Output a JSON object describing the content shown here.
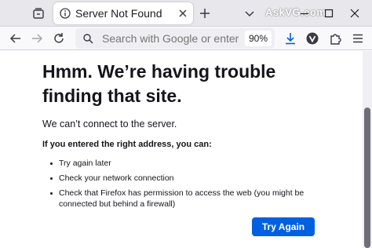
{
  "tab": {
    "title": "Server Not Found"
  },
  "watermark": "AskVG.com",
  "urlbar": {
    "placeholder": "Search with Google or enter address",
    "zoom": "90%"
  },
  "page": {
    "title": "Hmm. We’re having trouble finding that site.",
    "short_desc": "We can’t connect to the server.",
    "hint": "If you entered the right address, you can:",
    "suggestions": [
      "Try again later",
      "Check your network connection",
      "Check that Firefox has permission to access the web (you might be connected but behind a firewall)"
    ],
    "try_again": "Try Again"
  },
  "colors": {
    "accent": "#0061e0",
    "tab_strip": "#e8e7ec",
    "toolbar": "#f9f9fb"
  },
  "icons": [
    "tabs-list-icon",
    "info-icon",
    "close-icon",
    "plus-icon",
    "chevron-down-icon",
    "minimize-icon",
    "maximize-icon",
    "window-close-icon",
    "back-arrow-icon",
    "forward-arrow-icon",
    "reload-icon",
    "search-icon",
    "download-icon",
    "extension-v-icon",
    "puzzle-icon",
    "hamburger-icon"
  ]
}
